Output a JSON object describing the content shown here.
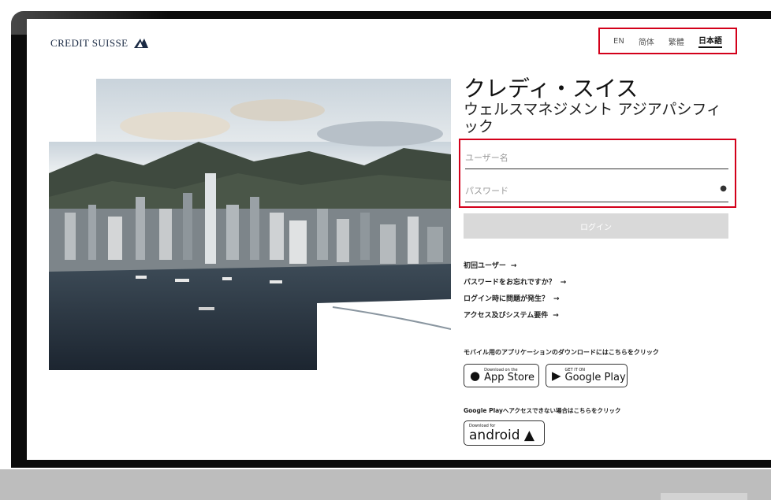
{
  "brand": {
    "name": "CREDIT SUISSE",
    "logo_icon": "sails-logo-icon"
  },
  "languages": [
    "EN",
    "简体",
    "繁體",
    "日本語"
  ],
  "active_language": "日本語",
  "title": {
    "line1": "クレディ・スイス",
    "line2": "ウェルスマネジメント アジアパシフィック"
  },
  "form": {
    "username_placeholder": "ユーザー名",
    "password_placeholder": "パスワード",
    "password_toggle_icon": "eye-icon",
    "login_label": "ログイン"
  },
  "links": [
    {
      "label": "初回ユーザー",
      "arrow": "→"
    },
    {
      "label": "パスワードをお忘れですか？",
      "arrow": "→"
    },
    {
      "label": "ログイン時に問題が発生？",
      "arrow": "→"
    },
    {
      "label": "アクセス及びシステム要件",
      "arrow": "→"
    }
  ],
  "mobile": {
    "prompt": "モバイル用のアプリケーションのダウンロードにはこちらをクリック",
    "appstore": {
      "small": "Download on the",
      "big": "App Store"
    },
    "googleplay": {
      "small": "GET IT ON",
      "big": "Google Play"
    },
    "gp_note": "Google Playへアクセスできない場合はこちらをクリック",
    "android": {
      "small": "Download for",
      "big": "android"
    }
  },
  "colors": {
    "highlight": "#d3001a",
    "button_bg": "#d9d9d9",
    "logo": "#1a2a44"
  }
}
